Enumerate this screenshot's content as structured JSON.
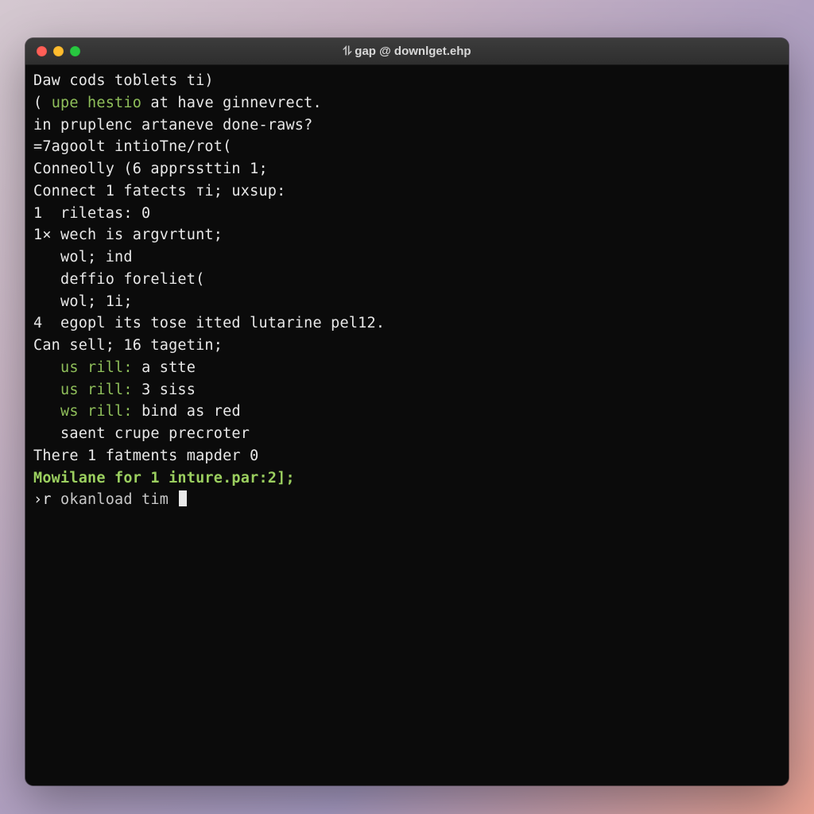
{
  "window": {
    "title_icon": "⥮",
    "title": "gap @ downlget.ehp"
  },
  "lines": {
    "l1": "Daw cods toblets ti)",
    "l2a": "( ",
    "l2b": "upe hestio",
    "l2c": " at have ginnevrect.",
    "l3": "in pruplenc artaneve done-raws?",
    "l4": "=7agoolt intioTne/rot(",
    "l5": "",
    "l6": "",
    "l7": "Conneolly (6 apprssttin 1;",
    "l8": "Connect 1 fatects тi; uxsup:",
    "l9": "1  riletas: 0",
    "l10": "1× wech is argvrtunt;",
    "l11": "   wol; ind",
    "l12": "   deffio foreliet(",
    "l13": "   wol; 1i;",
    "l14": "4  egopl its tose itted lutarine pel12.",
    "l15": "",
    "l16": "",
    "l17a": "Can sell; 16 tagetin;",
    "l18a": "   ",
    "l18b": "us rill:",
    "l18c": " a stte",
    "l19a": "   ",
    "l19b": "us rill:",
    "l19c": " 3 siss",
    "l20a": "   ",
    "l20b": "ws rill:",
    "l20c": " bind as red",
    "l21": "   saent crupe precroter",
    "l22": "",
    "l23": "",
    "l24": "There 1 fatments mapder 0",
    "l25": "Mowilane for 1 inture.par:2];",
    "l26a": "›r ",
    "l26b": "okanload tim "
  }
}
